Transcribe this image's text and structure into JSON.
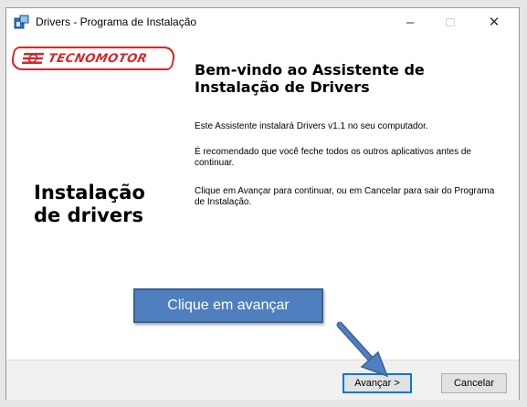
{
  "window": {
    "title": "Drivers - Programa de Instalação",
    "controls": {
      "minimize": "–",
      "maximize": "□",
      "close": "✕"
    }
  },
  "logo": {
    "text": "TECNOMOTOR",
    "color": "#d6262a"
  },
  "sidebar": {
    "title_line1": "Instalação",
    "title_line2": "de drivers"
  },
  "main": {
    "heading_line1": "Bem-vindo ao Assistente de",
    "heading_line2": "Instalação de Drivers",
    "paragraphs": [
      "Este Assistente instalará Drivers v1.1 no seu computador.",
      "É recomendado que você feche todos os outros aplicativos antes de continuar.",
      "Clique em Avançar para continuar, ou em Cancelar para sair do Programa de Instalação."
    ]
  },
  "footer": {
    "next_label": "Avançar >",
    "cancel_label": "Cancelar"
  },
  "annotation": {
    "callout_text": "Clique em avançar",
    "color": "#4f7fbf"
  }
}
